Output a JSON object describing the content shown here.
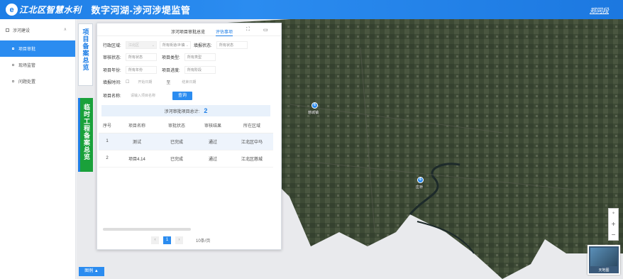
{
  "header": {
    "logo_glyph": "e",
    "logo_text": "江北区智慧水利",
    "title": "数字河湖-涉河涉堤监管",
    "user": "郑同段"
  },
  "sidebar": {
    "group_label": "涉河建设",
    "group_chevron": "∧",
    "items": [
      {
        "label": "项目审批",
        "active": true
      },
      {
        "label": "现场监管",
        "active": false
      },
      {
        "label": "问题处置",
        "active": false
      }
    ]
  },
  "vertical_tabs": {
    "tab1": "项目备案总览",
    "tab2": "临时工程备案总览"
  },
  "panel": {
    "tabs": [
      "涉河项目审批总览",
      "评估事项"
    ],
    "filters": {
      "region_label": "行政区域:",
      "region_value": "江北区",
      "street_value": "所有街道/乡镇",
      "audit_state_label": "填报状态:",
      "audit_state_value": "所有状态",
      "approve_state_label": "审核状态:",
      "approve_state_value": "所有状态",
      "project_type_label": "项目类型:",
      "project_type_value": "所有类型",
      "year_label": "项目年份:",
      "year_value": "所有年份",
      "progress_label": "项目进度:",
      "progress_value": "所有阶段",
      "time_label": "填报时间:",
      "time_start": "开始日期",
      "time_sep": "至",
      "time_end": "结束日期",
      "name_label": "项目名称:",
      "name_placeholder": "请输入项目名称",
      "query_button": "查询"
    },
    "count_label": "涉河审批项目总计:",
    "count_value": "2",
    "table": {
      "columns": [
        "序号",
        "项目名称",
        "审批状态",
        "审核结果",
        "所在区域"
      ],
      "rows": [
        [
          "1",
          "测试",
          "已完成",
          "通过",
          "江北区中马"
        ],
        [
          "2",
          "项目4.14",
          "已完成",
          "通过",
          "江北区慈城"
        ]
      ]
    },
    "pager": {
      "prev": "‹",
      "current": "1",
      "next": "›",
      "page_size": "10条/页"
    }
  },
  "map": {
    "markers": [
      {
        "count": "6",
        "label": "慈城镇"
      },
      {
        "count": "6",
        "label": "庄桥"
      }
    ],
    "zoom_in": "+",
    "zoom_out": "−",
    "basemap_label": "天地图",
    "legend_button": "图例 ▲"
  }
}
